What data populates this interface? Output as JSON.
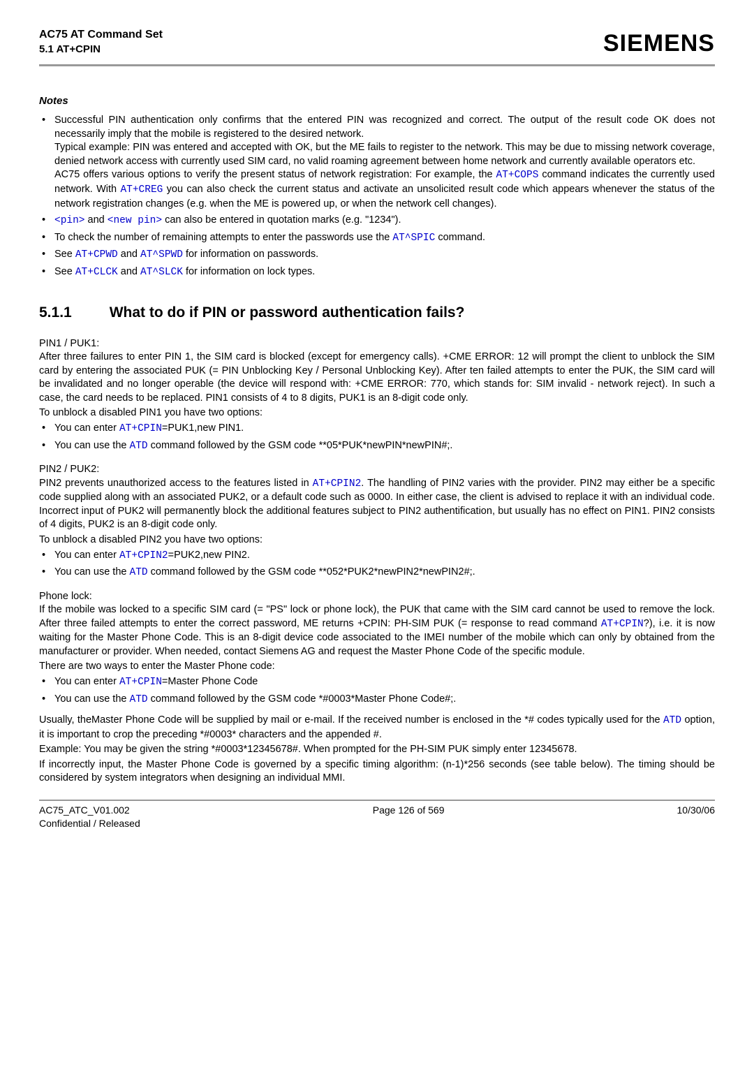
{
  "header": {
    "title_line1": "AC75 AT Command Set",
    "title_line2": "5.1 AT+CPIN",
    "logo": "SIEMENS"
  },
  "notes": {
    "heading": "Notes",
    "items": [
      "Successful PIN authentication only confirms that the entered PIN was recognized and correct. The output of the result code OK does not necessarily imply that the mobile is registered to the desired network. Typical example: PIN was entered and accepted with OK, but the ME fails to register to the network. This may be due to missing network coverage, denied network access with currently used SIM card, no valid roaming agreement between home network and currently available operators etc. AC75 offers various options to verify the present status of network registration: For example, the AT+COPS command indicates the currently used network. With AT+CREG you can also check the current status and activate an unsolicited result code which appears whenever the status of the network registration changes (e.g. when the ME is powered up, or when the network cell changes).",
      "<pin> and <new pin> can also be entered in quotation marks (e.g. \"1234\").",
      "To check the number of remaining attempts to enter the passwords use the AT^SPIC command.",
      "See AT+CPWD and AT^SPWD for information on passwords.",
      "See AT+CLCK and AT^SLCK for information on lock types."
    ]
  },
  "section": {
    "number": "5.1.1",
    "title": "What to do if PIN or password authentication fails?"
  },
  "pin1": {
    "label": "PIN1 / PUK1:",
    "body": "After three failures to enter PIN 1, the SIM card is blocked (except for emergency calls). +CME ERROR: 12 will prompt the client to unblock the SIM card by entering the associated PUK (= PIN Unblocking Key / Personal Unblocking Key). After ten failed attempts to enter the PUK, the SIM card will be invalidated and no longer operable (the device will respond with: +CME ERROR: 770, which stands for: SIM invalid - network reject). In such a case, the card needs to be replaced. PIN1 consists of 4 to 8 digits, PUK1 is an 8-digit code only.",
    "unblock": "To unblock a disabled PIN1 you have two options:",
    "opt1_pre": "You can enter ",
    "opt1_cmd": "AT+CPIN",
    "opt1_post": "=PUK1,new PIN1.",
    "opt2_pre": "You can use the ",
    "opt2_cmd": "ATD",
    "opt2_post": " command followed by the GSM code **05*PUK*newPIN*newPIN#;."
  },
  "pin2": {
    "label": "PIN2 / PUK2:",
    "body_pre": "PIN2 prevents unauthorized access to the features listed in ",
    "body_cmd": "AT+CPIN2",
    "body_post": ". The handling of PIN2 varies with the provider. PIN2 may either be a specific code supplied along with an associated PUK2, or a default code such as 0000. In either case, the client is advised to replace it with an individual code. Incorrect input of PUK2 will permanently block the additional features subject to PIN2 authentification, but usually has no effect on PIN1. PIN2 consists of 4 digits, PUK2 is an 8-digit code only.",
    "unblock": "To unblock a disabled PIN2 you have two options:",
    "opt1_pre": "You can enter ",
    "opt1_cmd": "AT+CPIN2",
    "opt1_post": "=PUK2,new PIN2.",
    "opt2_pre": "You can use the ",
    "opt2_cmd": "ATD",
    "opt2_post": " command followed by the GSM code **052*PUK2*newPIN2*newPIN2#;."
  },
  "phone": {
    "label": "Phone lock:",
    "body_pre": "If the mobile was locked to a specific SIM card (= \"PS\" lock or phone lock), the PUK that came with the SIM card cannot be used to remove the lock. After three failed attempts to enter the correct password, ME returns +CPIN: PH-SIM PUK (= response to read command ",
    "body_cmd": "AT+CPIN",
    "body_post": "?), i.e. it is now waiting for the Master Phone Code. This is an 8-digit device code associated to the IMEI number of the mobile which can only by obtained from the manufacturer or provider. When needed, contact Siemens AG and request the Master Phone Code of the specific module.",
    "ways": "There are two ways to enter the Master Phone code:",
    "opt1_pre": "You can enter ",
    "opt1_cmd": "AT+CPIN",
    "opt1_post": "=Master Phone Code",
    "opt2_pre": "You can use the ",
    "opt2_cmd": "ATD",
    "opt2_post": " command followed by the GSM code *#0003*Master Phone Code#;.",
    "usually_pre": "Usually, theMaster Phone Code will be supplied by mail or e-mail. If the received number is enclosed in the *# codes typically used for the ",
    "usually_cmd": "ATD",
    "usually_post": " option, it is important to crop the preceding *#0003* characters and the appended #.",
    "example": "Example: You may be given the string *#0003*12345678#. When prompted for the PH-SIM PUK simply enter 12345678.",
    "incorrect": "If incorrectly input, the Master Phone Code is governed by a specific timing algorithm: (n-1)*256 seconds (see table below). The timing should be considered by system integrators when designing an individual MMI."
  },
  "footer": {
    "left": "AC75_ATC_V01.002",
    "center": "Page 126 of 569",
    "right": "10/30/06",
    "left2": "Confidential / Released"
  }
}
